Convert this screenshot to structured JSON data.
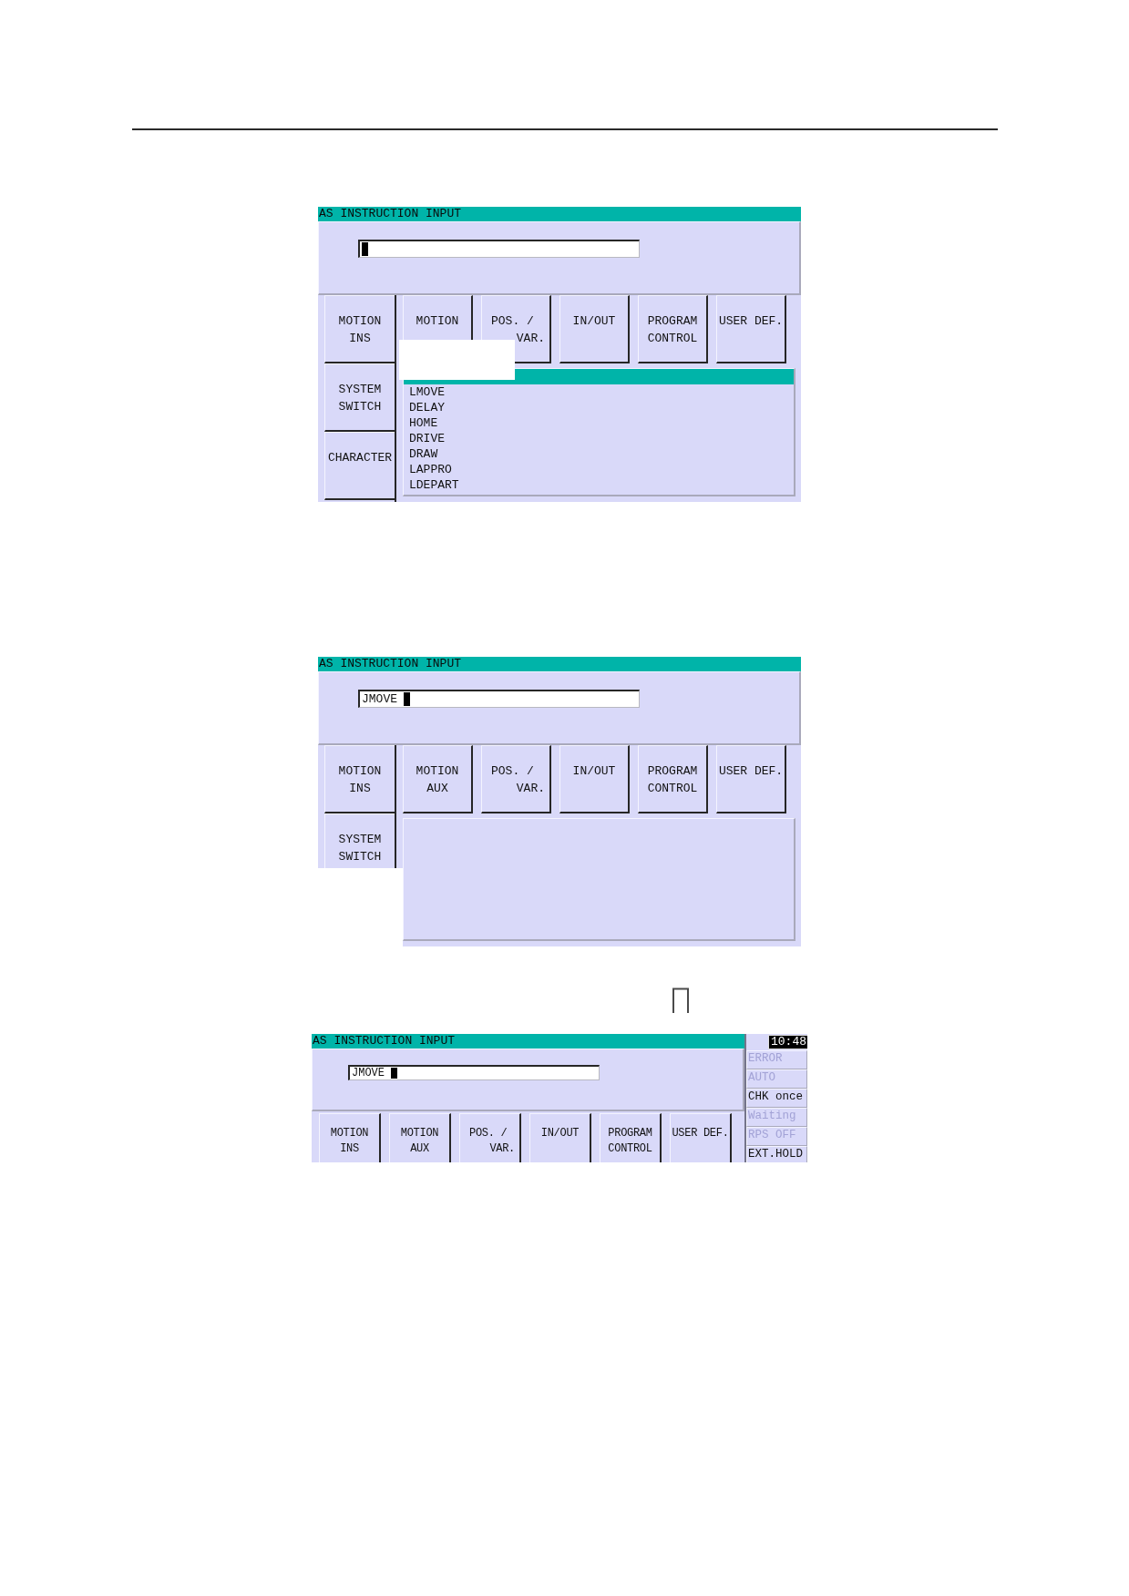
{
  "screens": [
    {
      "kind": "list-shown",
      "title": "AS INSTRUCTION INPUT",
      "side_buttons": [
        {
          "label": "MOTION\nINS"
        },
        {
          "label": "SYSTEM\nSWITCH"
        },
        {
          "label": "CHARACTER"
        }
      ],
      "buttons": [
        {
          "label": "MOTION",
          "kind": "centered"
        },
        {
          "label": "POS. /\nVAR.",
          "kind": "staggered"
        },
        {
          "label": "IN/OUT",
          "kind": "centered"
        },
        {
          "label": "PROGRAM\nCONTROL",
          "kind": "centered"
        },
        {
          "label": "USER DEF.",
          "kind": "centered"
        }
      ],
      "instructions": [
        {
          "selected": true
        },
        {
          "label": "LMOVE",
          "selected": false
        },
        {
          "label": "DELAY",
          "selected": false
        },
        {
          "label": "HOME",
          "selected": false
        },
        {
          "label": "DRIVE",
          "selected": false
        },
        {
          "label": "DRAW",
          "selected": false
        },
        {
          "label": "LAPPRO",
          "selected": false
        },
        {
          "label": "LDEPART",
          "selected": false
        }
      ]
    },
    {
      "kind": "list-blank",
      "title": "AS INSTRUCTION INPUT",
      "input_value": "JMOVE",
      "side_buttons": [
        {
          "label": "MOTION\nINS"
        },
        {
          "label": "SYSTEM\nSWITCH"
        }
      ],
      "buttons": [
        {
          "label": "MOTION\nAUX",
          "kind": "centered"
        },
        {
          "label": "POS. /\nVAR.",
          "kind": "staggered"
        },
        {
          "label": "IN/OUT",
          "kind": "centered"
        },
        {
          "label": "PROGRAM\nCONTROL",
          "kind": "centered"
        },
        {
          "label": "USER DEF.",
          "kind": "centered"
        }
      ]
    },
    {
      "kind": "status",
      "title": "AS INSTRUCTION INPUT",
      "input_value": "JMOVE",
      "buttons": [
        {
          "label": "MOTION\nINS",
          "kind": "centered"
        },
        {
          "label": "MOTION\nAUX",
          "kind": "centered"
        },
        {
          "label": "POS. /\nVAR.",
          "kind": "staggered"
        },
        {
          "label": "IN/OUT",
          "kind": "centered"
        },
        {
          "label": "PROGRAM\nCONTROL",
          "kind": "centered"
        },
        {
          "label": "USER DEF.",
          "kind": "centered"
        }
      ],
      "clock": "10:48",
      "status": [
        {
          "label": "ERROR",
          "active": false
        },
        {
          "label": "AUTO",
          "active": false
        },
        {
          "label": "CHK once",
          "active": true
        },
        {
          "label": "Waiting",
          "active": false
        },
        {
          "label": "RPS OFF",
          "active": false
        },
        {
          "label": "EXT.HOLD",
          "active": true
        }
      ]
    }
  ]
}
